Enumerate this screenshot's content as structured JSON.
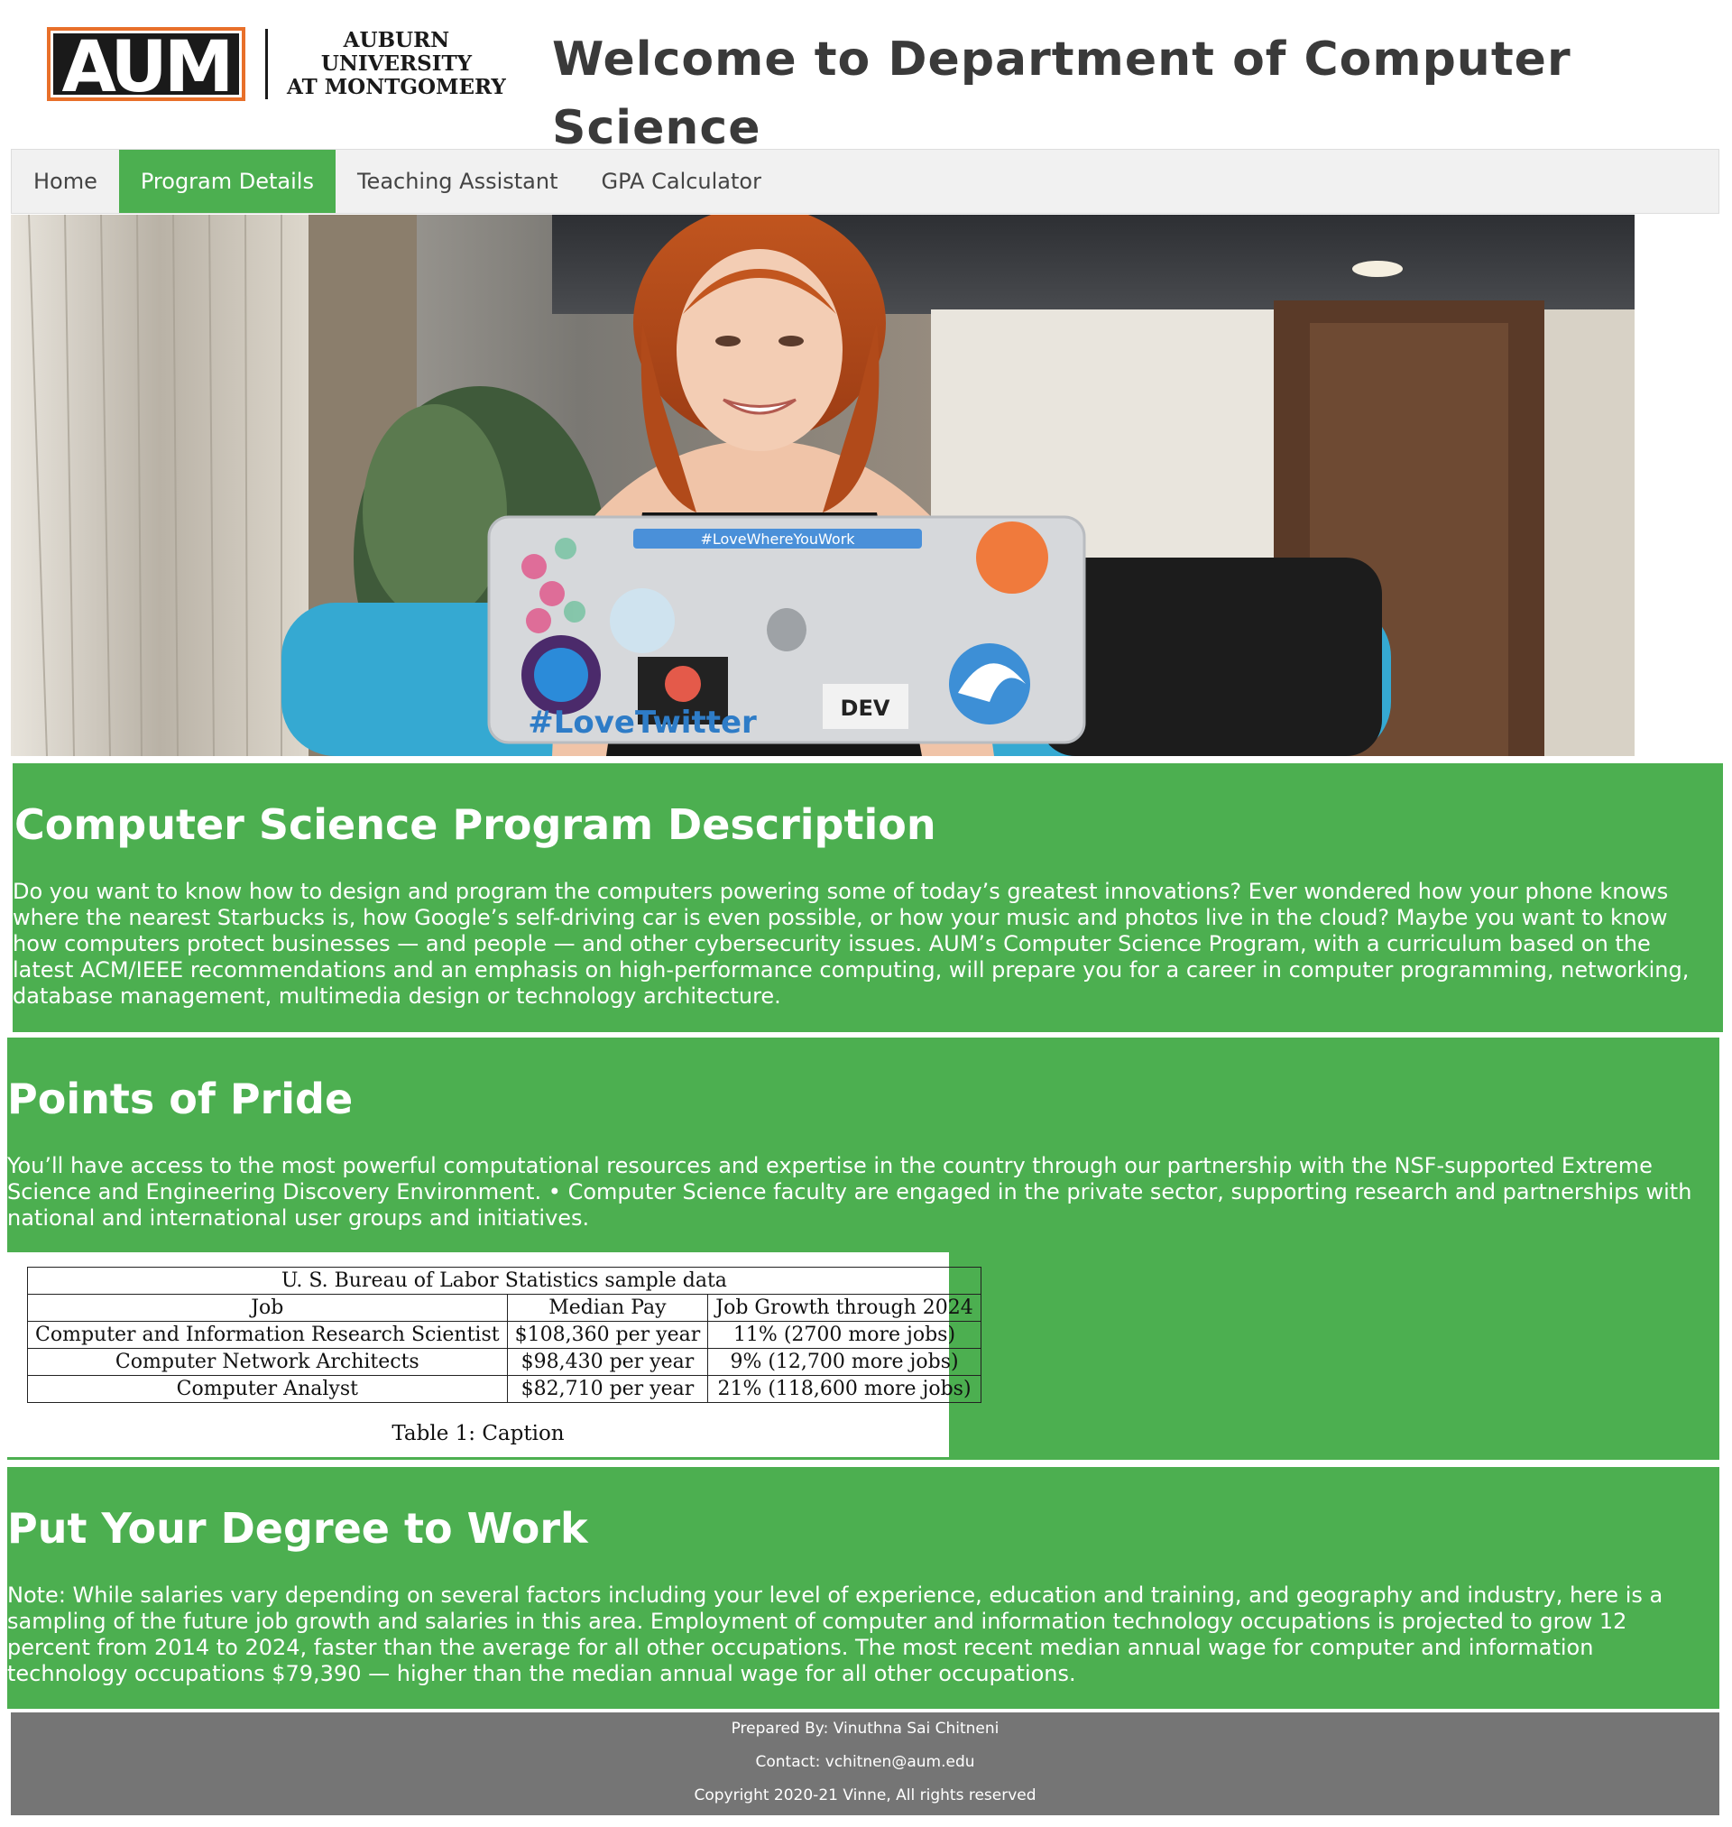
{
  "header": {
    "logo_mark": "AUM",
    "logo_line1": "AUBURN UNIVERSITY",
    "logo_line2": "AT MONTGOMERY",
    "title": "Welcome to Department of Computer Science"
  },
  "nav": {
    "items": [
      {
        "label": "Home",
        "active": false
      },
      {
        "label": "Program Details",
        "active": true
      },
      {
        "label": "Teaching Assistant",
        "active": false
      },
      {
        "label": "GPA Calculator",
        "active": false
      }
    ]
  },
  "hero": {
    "sticker_hashtag": "#LoveWhereYouWork",
    "laptop_text": "#LoveTwitter",
    "sticker_dev": "DEV"
  },
  "description": {
    "title": "Computer Science Program Description",
    "text": "Do you want to know how to design and program the computers powering some of today’s greatest innovations? Ever wondered how your phone knows where the nearest Starbucks is, how Google’s self-driving car is even possible, or how your music and photos live in the cloud? Maybe you want to know how computers protect businesses — and people — and other cybersecurity issues. AUM’s Computer Science Program, with a curriculum based on the latest ACM/IEEE recommendations and an emphasis on high-performance computing, will prepare you for a career in computer programming, networking, database management, multimedia design or technology architecture."
  },
  "pride": {
    "title": "Points of Pride",
    "text": "You’ll have access to the most powerful computational resources and expertise in the country through our partnership with the NSF-supported Extreme Science and Engineering Discovery Environment. • Computer Science faculty are engaged in the private sector, supporting research and partnerships with national and international user groups and initiatives."
  },
  "table": {
    "title": "U. S. Bureau of Labor Statistics sample data",
    "headers": [
      "Job",
      "Median Pay",
      "Job Growth through 2024"
    ],
    "rows": [
      [
        "Computer and Information Research Scientist",
        "$108,360 per year",
        "11% (2700 more jobs)"
      ],
      [
        "Computer Network Architects",
        "$98,430 per year",
        "9% (12,700 more jobs)"
      ],
      [
        "Computer Analyst",
        "$82,710 per year",
        "21% (118,600 more jobs)"
      ]
    ],
    "caption": "Table 1: Caption"
  },
  "work": {
    "title": "Put Your Degree to Work",
    "text": "Note: While salaries vary depending on several factors including your level of experience, education and training, and geography and industry, here is a sampling of the future job growth and salaries in this area. Employment of computer and information technology occupations is projected to grow 12 percent from 2014 to 2024, faster than the average for all other occupations. The most recent median annual wage for computer and information technology occupations $79,390 — higher than the median annual wage for all other occupations."
  },
  "footer": {
    "prepared_by": "Prepared By: Vinuthna Sai Chitneni",
    "contact": "Contact: vchitnen@aum.edu",
    "copyright": "Copyright 2020-21 Vinne, All rights reserved"
  },
  "colors": {
    "accent_green": "#4caf50",
    "nav_bg": "#f1f1f1",
    "footer_bg": "#757575",
    "logo_orange": "#e8702a"
  }
}
